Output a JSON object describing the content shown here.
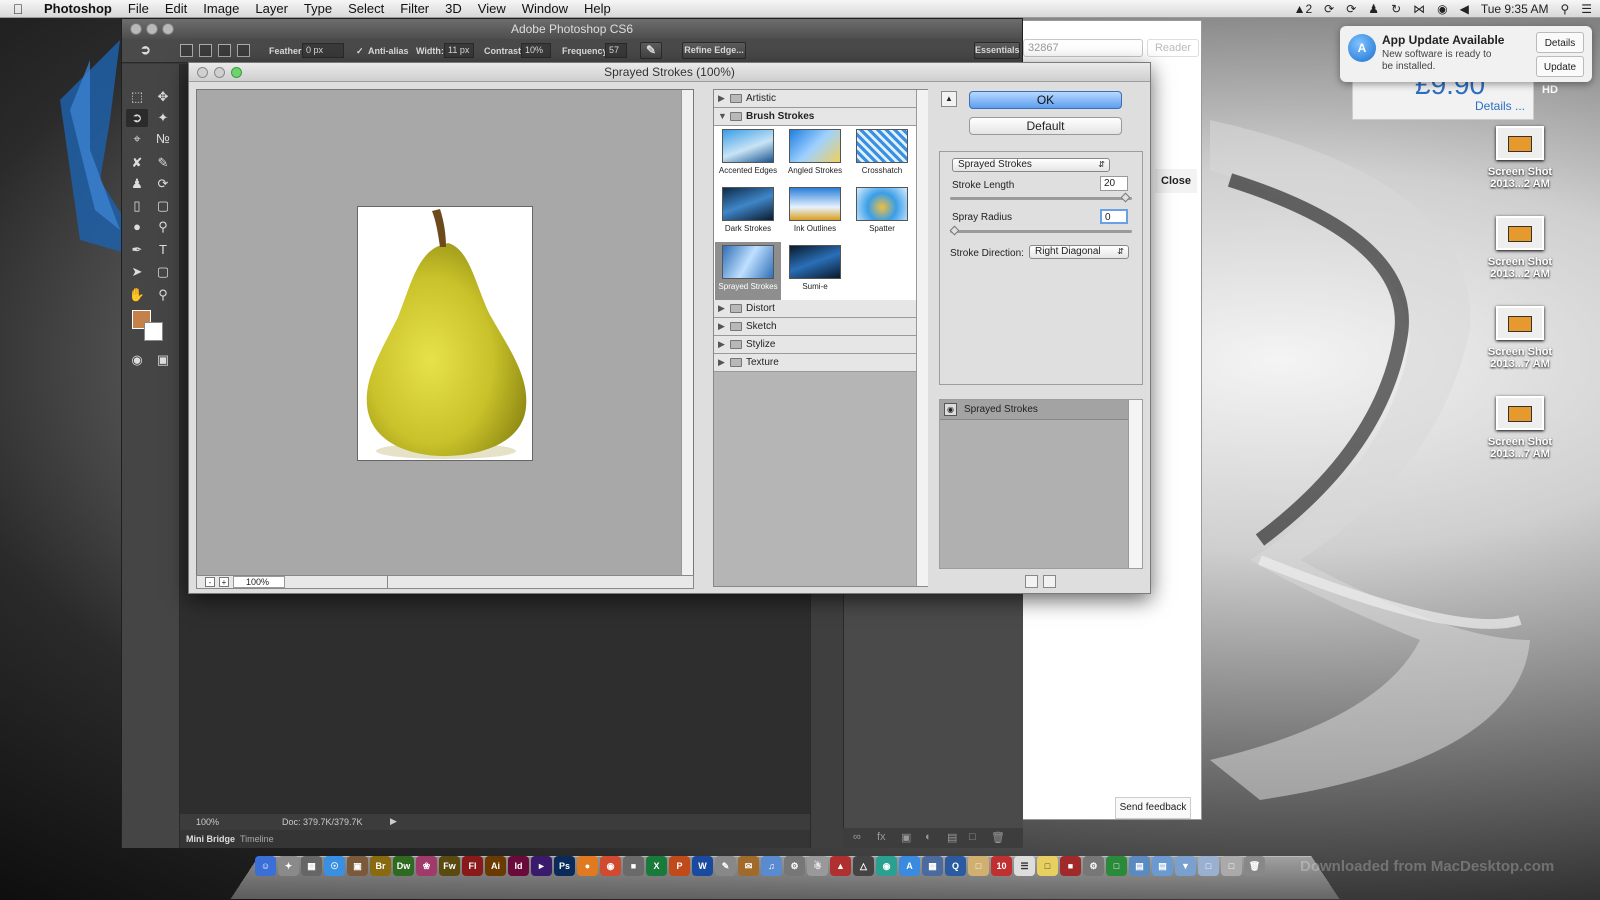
{
  "menubar": {
    "app_name": "Photoshop",
    "items": [
      "File",
      "Edit",
      "Image",
      "Layer",
      "Type",
      "Select",
      "Filter",
      "3D",
      "View",
      "Window",
      "Help"
    ],
    "status_badge": "2",
    "clock": "Tue 9:35 AM"
  },
  "notification": {
    "title": "App Update Available",
    "body": "New software is ready to be installed.",
    "details_label": "Details",
    "update_label": "Update"
  },
  "browser": {
    "address_fragment": "32867",
    "reader_label": "Reader",
    "close_label": "Close",
    "feedback_label": "Send feedback",
    "ad_price": "£9.90",
    "ad_details": "Details ...",
    "hd_label": "HD"
  },
  "desktop_icons": [
    {
      "line1": "Screen Shot",
      "line2": "2013...2 AM"
    },
    {
      "line1": "Screen Shot",
      "line2": "2013...2 AM"
    },
    {
      "line1": "Screen Shot",
      "line2": "2013...7 AM"
    },
    {
      "line1": "Screen Shot",
      "line2": "2013...7 AM"
    }
  ],
  "ps": {
    "window_title": "Adobe Photoshop CS6",
    "options": {
      "feather_label": "Feather:",
      "feather_value": "0 px",
      "antialias_label": "Anti-alias",
      "width_label": "Width:",
      "width_value": "11 px",
      "contrast_label": "Contrast:",
      "contrast_value": "10%",
      "frequency_label": "Frequency:",
      "frequency_value": "57",
      "refine_edge_label": "Refine Edge...",
      "workspace_label": "Essentials"
    },
    "status": {
      "zoom": "100%",
      "doc": "Doc: 379.7K/379.7K"
    },
    "bottom_tabs": [
      "Mini Bridge",
      "Timeline"
    ],
    "colors": {
      "foreground": "#c4824a",
      "background": "#ffffff"
    }
  },
  "dialog": {
    "title": "Sprayed Strokes (100%)",
    "preview_zoom": "100%",
    "categories": {
      "artistic": "Artistic",
      "brush_strokes": "Brush Strokes",
      "distort": "Distort",
      "sketch": "Sketch",
      "stylize": "Stylize",
      "texture": "Texture"
    },
    "brush_filters": [
      "Accented Edges",
      "Angled Strokes",
      "Crosshatch",
      "Dark Strokes",
      "Ink Outlines",
      "Spatter",
      "Sprayed Strokes",
      "Sumi-e"
    ],
    "selected_filter": "Sprayed Strokes",
    "ok_label": "OK",
    "default_label": "Default",
    "filter_select": "Sprayed Strokes",
    "params": {
      "stroke_length_label": "Stroke Length",
      "stroke_length_value": "20",
      "stroke_length_level": 1.0,
      "spray_radius_label": "Spray Radius",
      "spray_radius_value": "0",
      "spray_radius_level": 0.0,
      "stroke_direction_label": "Stroke Direction:",
      "stroke_direction_value": "Right Diagonal"
    },
    "effect_layer": "Sprayed Strokes"
  },
  "watermark": "Downloaded from MacDesktop.com"
}
